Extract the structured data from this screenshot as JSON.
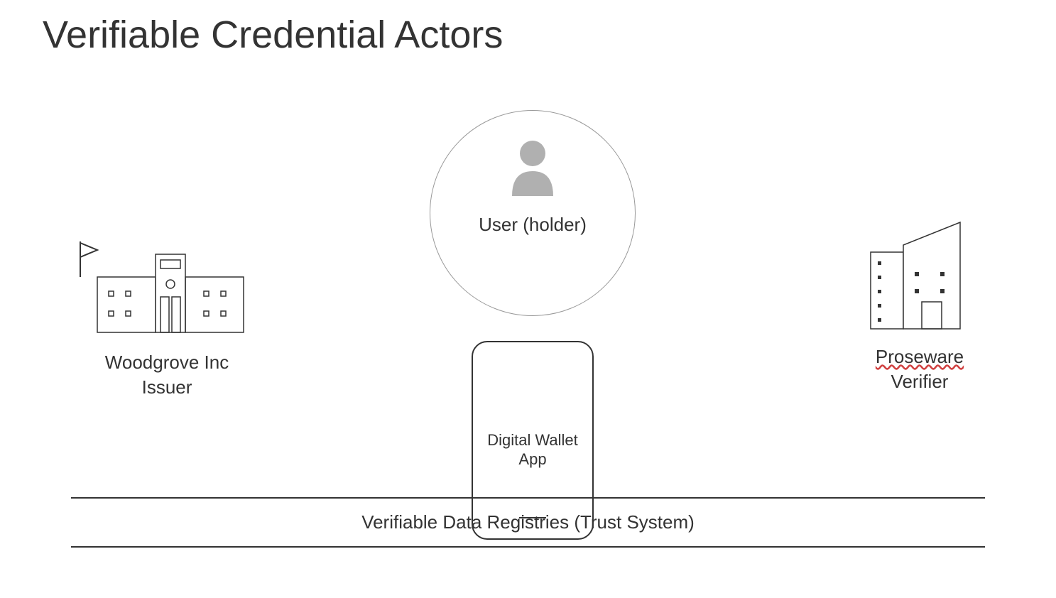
{
  "title": "Verifiable Credential Actors",
  "issuer": {
    "name": "Woodgrove Inc",
    "role": "Issuer"
  },
  "holder": {
    "label": "User (holder)",
    "app_line1": "Digital Wallet",
    "app_line2": "App"
  },
  "verifier": {
    "name": "Proseware",
    "role": "Verifier"
  },
  "registry": {
    "label": "Verifiable Data Registries (Trust System)"
  }
}
